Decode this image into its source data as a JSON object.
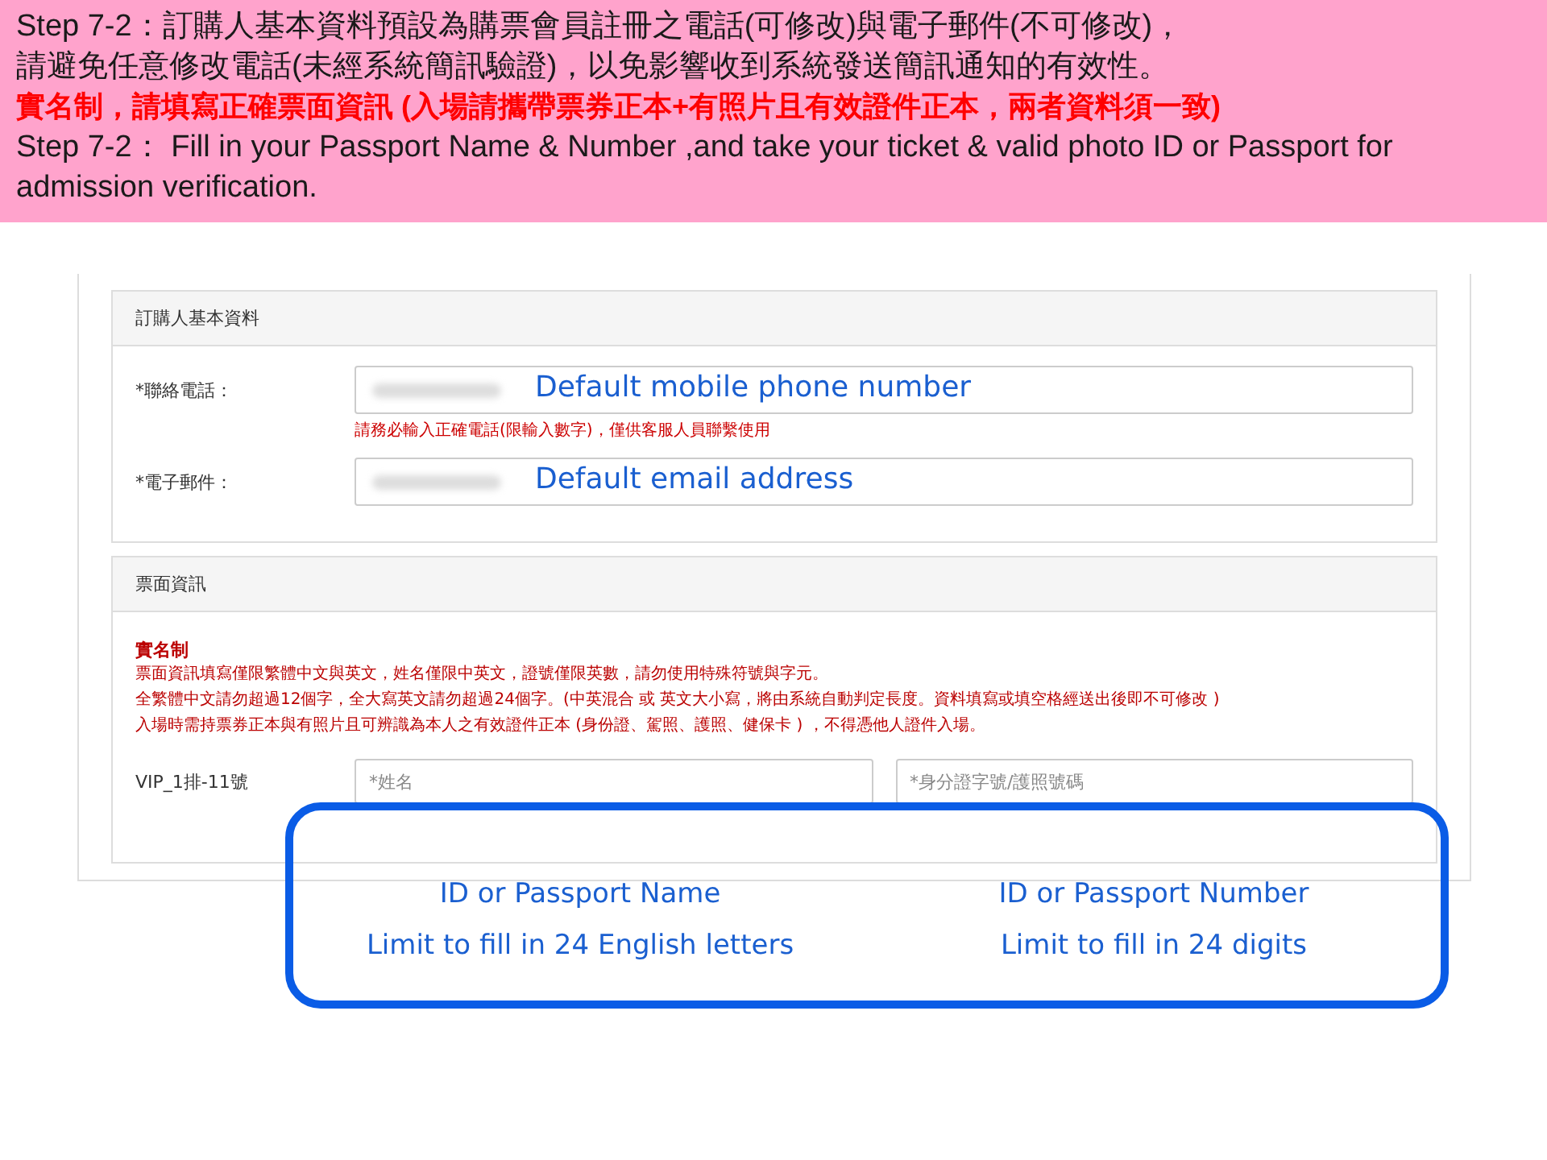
{
  "instructions": [
    {
      "kind": "plain",
      "text": "Step 7-2：訂購人基本資料預設為購票會員註冊之電話(可修改)與電子郵件(不可修改)，"
    },
    {
      "kind": "plain",
      "text": "請避免任意修改電話(未經系統簡訊驗證)，以免影響收到系統發送簡訊通知的有效性。"
    },
    {
      "kind": "warning",
      "text": "實名制，請填寫正確票面資訊  (入場請攜帶票券正本+有照片且有效證件正本，兩者資料須一致)"
    },
    {
      "kind": "plain",
      "text": "Step 7-2： Fill in your Passport Name & Number ,and take your ticket & valid photo ID or Passport for admission verification."
    }
  ],
  "buyer_section": {
    "title": "訂購人基本資料",
    "fields": [
      {
        "label": "*聯絡電話：",
        "annotation": "Default mobile phone number",
        "note": "請務必輸入正確電話(限輸入數字)，僅供客服人員聯繫使用"
      },
      {
        "label": "*電子郵件：",
        "annotation": "Default email address"
      }
    ]
  },
  "ticket_section": {
    "title": "票面資訊",
    "notice_title": "實名制",
    "notice_lines": [
      "票面資訊填寫僅限繁體中文與英文，姓名僅限中英文，證號僅限英數，請勿使用特殊符號與字元。",
      "全繁體中文請勿超過12個字，全大寫英文請勿超過24個字。(中英混合  或  英文大小寫，將由系統自動判定長度。資料填寫或填空格經送出後即不可修改 )",
      "入場時需持票券正本與有照片且可辨識為本人之有效證件正本  (身份證、駕照、護照、健保卡 ) ，不得憑他人證件入場。"
    ],
    "seat_label": "VIP_1排-11號",
    "inputs": [
      {
        "placeholder": "*姓名",
        "annotation": "ID or Passport Name",
        "limit": "Limit to fill in 24 English letters"
      },
      {
        "placeholder": "*身分證字號/護照號碼",
        "annotation": "ID or Passport Number",
        "limit": "Limit to fill in 24 digits"
      }
    ]
  }
}
